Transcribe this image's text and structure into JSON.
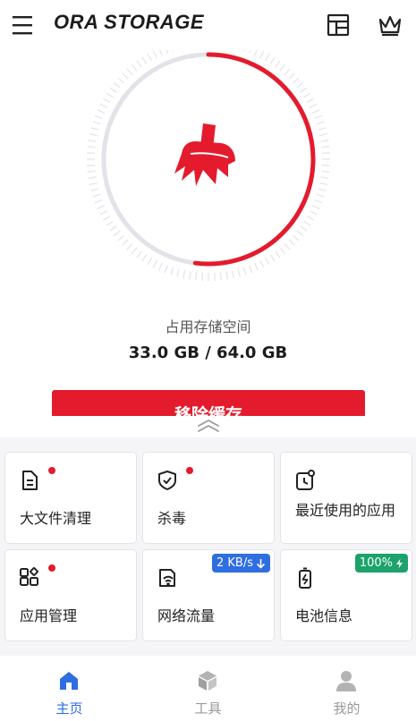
{
  "app": {
    "brand": "ORA STORAGE"
  },
  "header": {
    "menu_icon": "hamburger-menu-icon",
    "layout_icon": "layout-icon",
    "premium_icon": "crown-icon"
  },
  "storage": {
    "label": "占用存储空间",
    "value": "33.0 GB / 64.0 GB",
    "used_gb": 33.0,
    "total_gb": 64.0,
    "used_fraction": 0.52,
    "accent_color": "#e31b2d",
    "icon": "broom-icon"
  },
  "clean_button": {
    "label": "移除缓存"
  },
  "tools": [
    {
      "label": "大文件清理",
      "icon": "document-icon",
      "dot": true
    },
    {
      "label": "杀毒",
      "icon": "shield-check-icon",
      "dot": true
    },
    {
      "label": "最近使用的应用",
      "icon": "recent-apps-clock-icon",
      "dot": false
    },
    {
      "label": "应用管理",
      "icon": "app-grid-icon",
      "dot": true
    },
    {
      "label": "网络流量",
      "icon": "network-traffic-icon",
      "badge": "2 KB/s",
      "badge_color": "#2f6ee0"
    },
    {
      "label": "电池信息",
      "icon": "battery-icon",
      "badge": "100%",
      "badge_color": "#1ba36b"
    }
  ],
  "bottom_nav": [
    {
      "label": "主页",
      "icon": "home-icon",
      "active": true
    },
    {
      "label": "工具",
      "icon": "cube-icon",
      "active": false
    },
    {
      "label": "我的",
      "icon": "person-icon",
      "active": false
    }
  ],
  "colors": {
    "accent": "#e31b2d",
    "active_nav": "#2f6ee0",
    "inactive_nav": "#9a9a9a",
    "panel_bg": "#f5f5f7"
  }
}
